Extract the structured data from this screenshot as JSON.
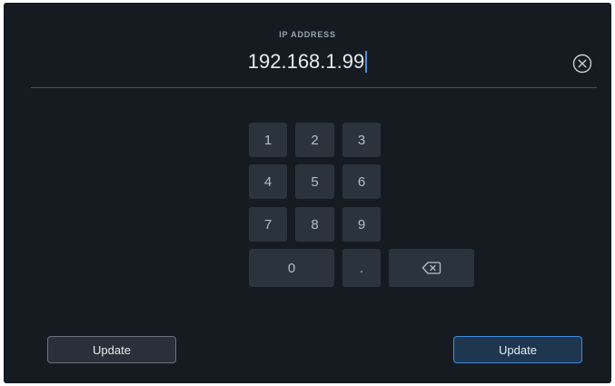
{
  "field": {
    "label": "IP ADDRESS",
    "value": "192.168.1.99"
  },
  "icons": {
    "clear": "close-circle-icon",
    "backspace": "backspace-icon"
  },
  "keypad": {
    "k1": "1",
    "k2": "2",
    "k3": "3",
    "k4": "4",
    "k5": "5",
    "k6": "6",
    "k7": "7",
    "k8": "8",
    "k9": "9",
    "k0": "0",
    "dot": "."
  },
  "actions": {
    "left_label": "Update",
    "right_label": "Update"
  },
  "colors": {
    "background": "#161b22",
    "key": "#2b333d",
    "accent": "#3f8ddf",
    "caret": "#4a8fe6"
  }
}
